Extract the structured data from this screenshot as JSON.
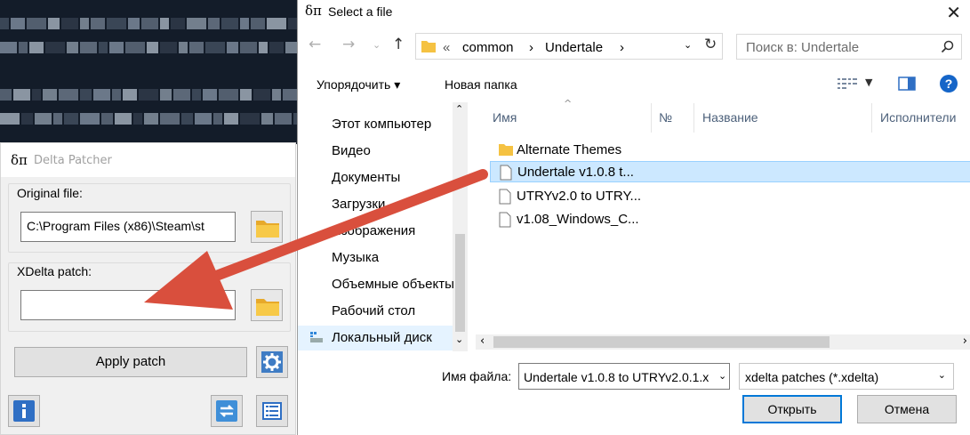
{
  "patcher": {
    "logo": "δπ",
    "title": "Delta Patcher",
    "original_label": "Original file:",
    "original_value": "C:\\Program Files (x86)\\Steam\\st",
    "xdelta_label": "XDelta patch:",
    "xdelta_value": "",
    "apply_label": "Apply patch"
  },
  "dialog": {
    "logo": "δπ",
    "title": "Select a file",
    "close": "✕",
    "breadcrumb": [
      "«",
      "common",
      "›",
      "Undertale",
      "›"
    ],
    "search_placeholder": "Поиск в: Undertale",
    "toolbar": {
      "organize": "Упорядочить ▾",
      "new_folder": "Новая папка"
    },
    "nav_items": [
      {
        "label": "Этот компьютер",
        "icon": "computer-icon"
      },
      {
        "label": "Видео",
        "icon": "video-icon"
      },
      {
        "label": "Документы",
        "icon": "documents-icon"
      },
      {
        "label": "Загрузки",
        "icon": "downloads-icon"
      },
      {
        "label": "Изображения",
        "icon": "pictures-icon"
      },
      {
        "label": "Музыка",
        "icon": "music-icon"
      },
      {
        "label": "Объемные объекты",
        "icon": "3d-objects-icon"
      },
      {
        "label": "Рабочий стол",
        "icon": "desktop-icon"
      },
      {
        "label": "Локальный диск",
        "icon": "drive-icon"
      }
    ],
    "columns": [
      "Имя",
      "№",
      "Название",
      "Исполнители"
    ],
    "files": [
      {
        "name": "Alternate Themes",
        "type": "folder",
        "selected": false
      },
      {
        "name": "Undertale v1.0.8 t...",
        "type": "file",
        "selected": true
      },
      {
        "name": "UTRYv2.0 to UTRY...",
        "type": "file",
        "selected": false
      },
      {
        "name": "v1.08_Windows_C...",
        "type": "file",
        "selected": false
      }
    ],
    "filename_label": "Имя файла:",
    "filename_value": "Undertale v1.0.8 to UTRYv2.0.1.x",
    "filter_value": "xdelta patches (*.xdelta)",
    "open_label": "Открыть",
    "cancel_label": "Отмена"
  },
  "colors": {
    "accent": "#0078d7",
    "selection": "#cce8ff",
    "arrow": "#d94f3d",
    "folder": "#f5c242"
  }
}
